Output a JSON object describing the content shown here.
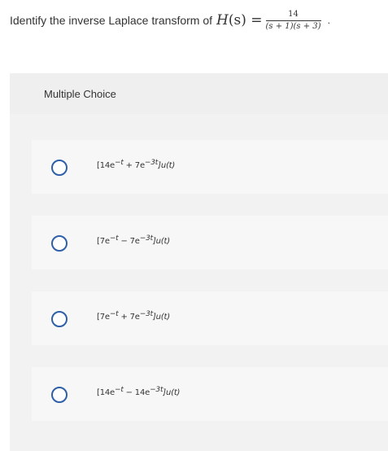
{
  "question": {
    "text": "Identify the inverse Laplace transform of",
    "func_var": "H",
    "func_arg": "(s) =",
    "numerator": "14",
    "denominator": "(s + 1)(s + 3)",
    "period": "."
  },
  "multiple_choice": {
    "label": "Multiple Choice",
    "options": [
      {
        "coef1": "[14e",
        "exp1": "−t",
        "op": " + 7e",
        "exp2": "−3t",
        "tail": "]u(t)"
      },
      {
        "coef1": "[7e",
        "exp1": "−t",
        "op": " − 7e",
        "exp2": "−3t",
        "tail": "]u(t)"
      },
      {
        "coef1": "[7e",
        "exp1": "−t",
        "op": " + 7e",
        "exp2": "−3t",
        "tail": "]u(t)"
      },
      {
        "coef1": "[14e",
        "exp1": "−t",
        "op": " − 14e",
        "exp2": "−3t",
        "tail": "]u(t)"
      }
    ]
  },
  "colors": {
    "radio_border": "#2f5fa7",
    "panel_bg": "#f2f2f2",
    "option_bg": "#f7f7f7"
  }
}
